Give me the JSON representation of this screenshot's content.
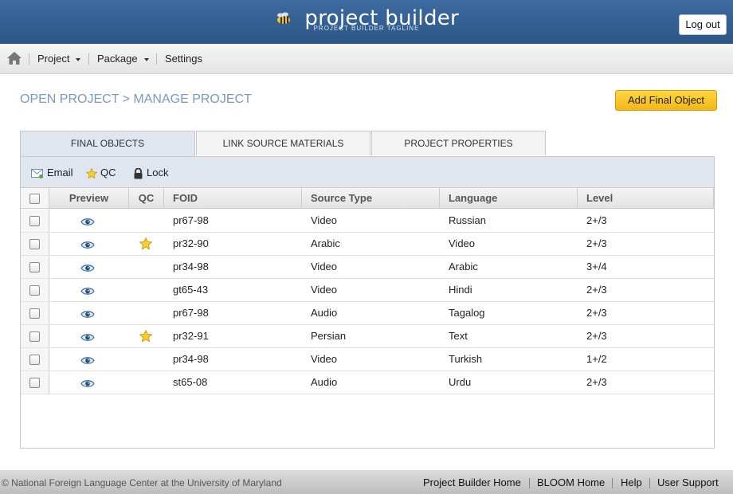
{
  "app": {
    "title": "project builder",
    "tagline": "PROJECT BUILDER TAGLINE",
    "logout_label": "Log out"
  },
  "nav": {
    "home_icon": "home-icon",
    "items": [
      {
        "label": "Project",
        "has_menu": true
      },
      {
        "label": "Package",
        "has_menu": true
      },
      {
        "label": "Settings",
        "has_menu": false
      }
    ]
  },
  "page": {
    "breadcrumb": "OPEN PROJECT > MANAGE PROJECT",
    "add_button_label": "Add Final Object"
  },
  "tabs": [
    {
      "label": "FINAL OBJECTS",
      "active": true
    },
    {
      "label": "LINK SOURCE MATERIALS",
      "active": false
    },
    {
      "label": "PROJECT PROPERTIES",
      "active": false
    }
  ],
  "toolbar": {
    "email_label": "Email",
    "qc_label": "QC",
    "lock_label": "Lock"
  },
  "table": {
    "columns": [
      "Preview",
      "QC",
      "FOID",
      "Source Type",
      "Language",
      "Level"
    ],
    "rows": [
      {
        "qc": false,
        "foid": "pr67-98",
        "source_type": "Video",
        "language": "Russian",
        "level": "2+/3"
      },
      {
        "qc": true,
        "foid": "pr32-90",
        "source_type": "Arabic",
        "language": "Video",
        "level": "2+/3"
      },
      {
        "qc": false,
        "foid": "pr34-98",
        "source_type": "Video",
        "language": "Arabic",
        "level": "3+/4"
      },
      {
        "qc": false,
        "foid": "gt65-43",
        "source_type": "Video",
        "language": "Hindi",
        "level": "2+/3"
      },
      {
        "qc": false,
        "foid": "pr67-98",
        "source_type": "Audio",
        "language": "Tagalog",
        "level": "2+/3"
      },
      {
        "qc": true,
        "foid": "pr32-91",
        "source_type": "Persian",
        "language": "Text",
        "level": "2+/3"
      },
      {
        "qc": false,
        "foid": "pr34-98",
        "source_type": "Video",
        "language": "Turkish",
        "level": "1+/2"
      },
      {
        "qc": false,
        "foid": "st65-08",
        "source_type": "Audio",
        "language": "Urdu",
        "level": "2+/3"
      }
    ]
  },
  "footer": {
    "copyright": "© National Foreign Language Center at the University of Maryland",
    "links": [
      "Project Builder Home",
      "BLOOM Home",
      "Help",
      "User Support"
    ]
  },
  "colors": {
    "header_blue": "#2c5586",
    "accent_yellow": "#f2b71a",
    "breadcrumb": "#7a99bf"
  }
}
